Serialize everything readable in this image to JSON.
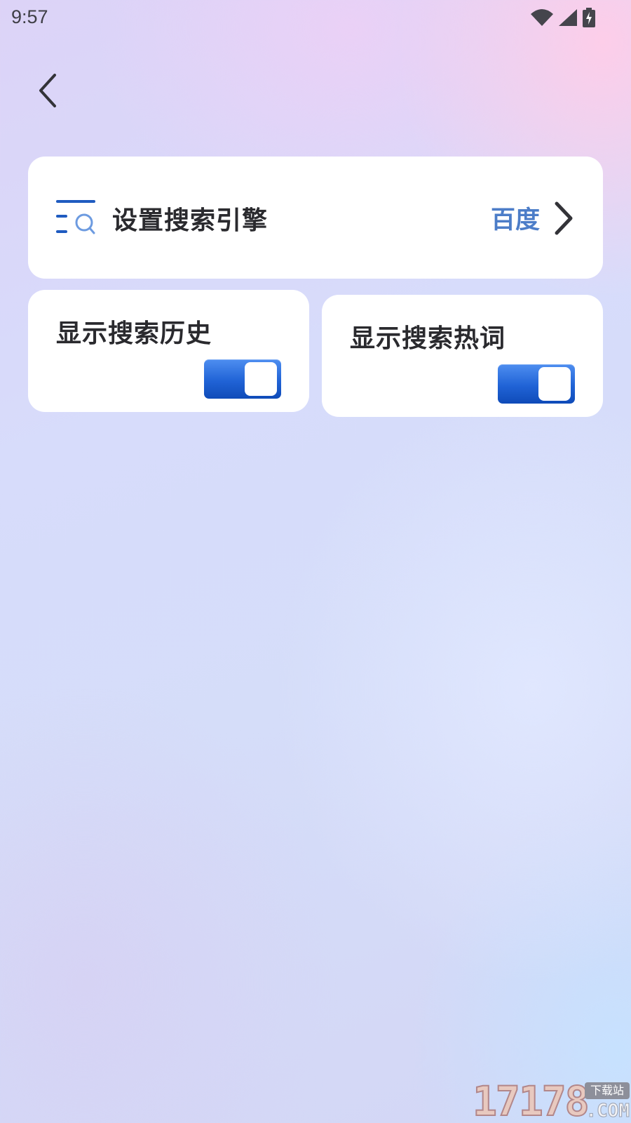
{
  "status_bar": {
    "time": "9:57",
    "icons": [
      "wifi-icon",
      "cellular-signal-icon",
      "battery-charging-icon"
    ]
  },
  "nav": {
    "back_icon": "chevron-left-icon"
  },
  "search_engine_row": {
    "icon": "list-search-icon",
    "label": "设置搜索引擎",
    "value": "百度",
    "chevron": "chevron-right-icon"
  },
  "search_history": {
    "label": "显示搜索历史",
    "enabled": true
  },
  "hot_words": {
    "label": "显示搜索热词",
    "enabled": true
  },
  "watermark": {
    "digits": "17178",
    "badge": "下载站",
    "suffix": ".COM"
  },
  "colors": {
    "accent_text": "#4c7dc8",
    "toggle_on": "#2063d6",
    "title_text": "#2a2a2e"
  }
}
